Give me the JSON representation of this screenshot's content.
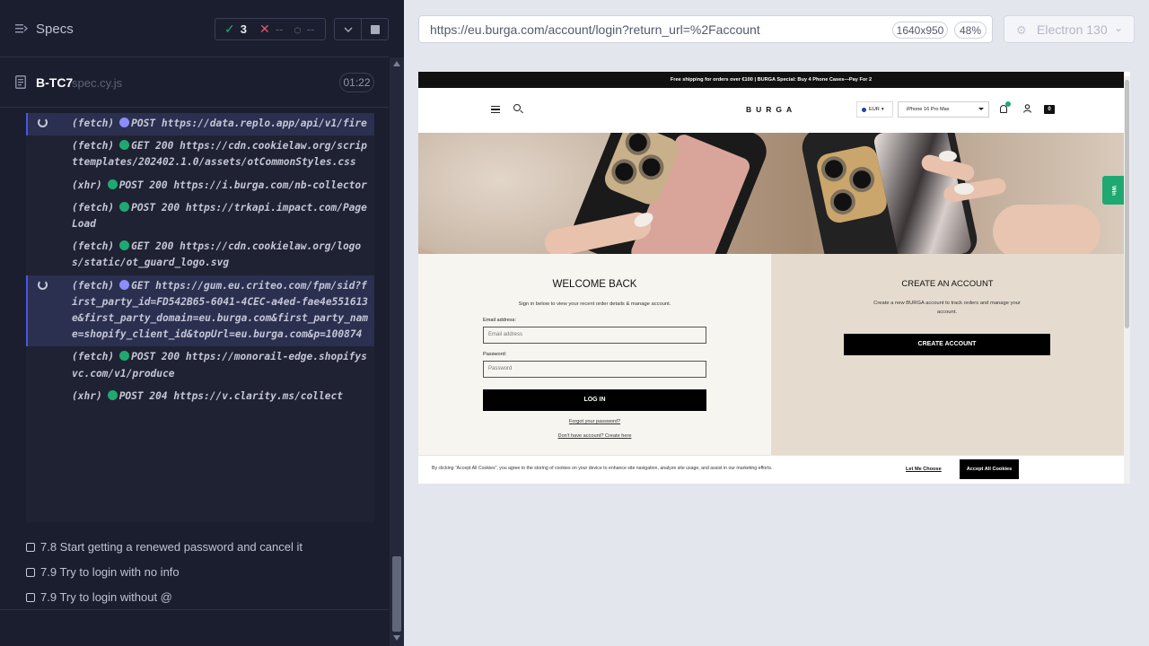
{
  "reporter": {
    "specs_title": "Specs",
    "stats": {
      "passed": "3",
      "failed": "--",
      "pending": "--"
    },
    "spec": {
      "name": "B-TC7",
      "file": "spec.cy.js",
      "duration": "01:22"
    },
    "commands": [
      {
        "type": "(fetch)",
        "dot": "purple",
        "method": "POST",
        "status": "",
        "url": "https://data.replo.app/api/v1/fire",
        "pending": true
      },
      {
        "type": "(fetch)",
        "dot": "green",
        "method": "GET",
        "status": "200",
        "url": "https://cdn.cookielaw.org/scripttemplates/202402.1.0/assets/otCommonStyles.css",
        "pending": false
      },
      {
        "type": "(xhr)",
        "dot": "green",
        "method": "POST",
        "status": "200",
        "url": "https://i.burga.com/nb-collector",
        "pending": false
      },
      {
        "type": "(fetch)",
        "dot": "green",
        "method": "POST",
        "status": "200",
        "url": "https://trkapi.impact.com/PageLoad",
        "pending": false
      },
      {
        "type": "(fetch)",
        "dot": "green",
        "method": "GET",
        "status": "200",
        "url": "https://cdn.cookielaw.org/logos/static/ot_guard_logo.svg",
        "pending": false
      },
      {
        "type": "(fetch)",
        "dot": "purple",
        "method": "GET",
        "status": "",
        "url": "https://gum.eu.criteo.com/fpm/sid?first_party_id=FD542B65-6041-4CEC-a4ed-fae4e551613e&first_party_domain=eu.burga.com&first_party_name=shopify_client_id&topUrl=eu.burga.com&p=100874",
        "pending": true
      },
      {
        "type": "(fetch)",
        "dot": "green",
        "method": "POST",
        "status": "200",
        "url": "https://monorail-edge.shopifysvc.com/v1/produce",
        "pending": false
      },
      {
        "type": "(xhr)",
        "dot": "green",
        "method": "POST",
        "status": "204",
        "url": "https://v.clarity.ms/collect",
        "pending": false
      }
    ],
    "tests": [
      {
        "label": "7.8 Start getting a renewed password and cancel it"
      },
      {
        "label": "7.9 Try to login with no info"
      },
      {
        "label": "7.9 Try to login without @"
      }
    ]
  },
  "browser": {
    "url": "https://eu.burga.com/account/login?return_url=%2Faccount",
    "viewport": "1640x950",
    "zoom": "48%",
    "browser_name": "Electron 130"
  },
  "site": {
    "promo": "Free shipping for orders over €100   |   BURGA Special: Buy 4 Phone Cases—Pay For 2",
    "logo": "BURGA",
    "currency": "EUR",
    "model": "iPhone 16 Pro Max",
    "cart_count": "0",
    "side_tab": "Win",
    "login": {
      "title": "WELCOME BACK",
      "subtitle": "Sign in below to view your recent order details & manage account.",
      "email_label": "Email address:",
      "email_placeholder": "Email address",
      "password_label": "Password:",
      "password_placeholder": "Password",
      "submit": "LOG IN",
      "forgot": "Forgot your password?",
      "no_account": "Don't have account? Create here"
    },
    "create": {
      "title": "CREATE AN ACCOUNT",
      "text": "Create a new BURGA account to track orders and manage your account.",
      "button": "CREATE ACCOUNT"
    },
    "cookie": {
      "text": "By clicking “Accept All Cookies”, you agree to the storing of cookies on your device to enhance site navigation, analyze site usage, and assist in our marketing efforts.",
      "choose": "Let Me Choose",
      "accept": "Accept All Cookies"
    }
  }
}
